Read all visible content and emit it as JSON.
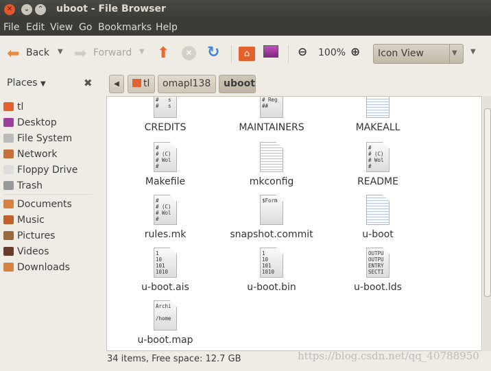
{
  "window": {
    "title": "uboot - File Browser"
  },
  "menu": [
    "File",
    "Edit",
    "View",
    "Go",
    "Bookmarks",
    "Help"
  ],
  "toolbar": {
    "back": "Back",
    "forward": "Forward",
    "zoom": "100%",
    "view": "Icon View"
  },
  "location": {
    "crumbs": [
      "tl",
      "omapl138",
      "uboot"
    ]
  },
  "sidebar": {
    "title": "Places",
    "items": [
      "tl",
      "Desktop",
      "File System",
      "Network",
      "Floppy Drive",
      "Trash",
      "Documents",
      "Music",
      "Pictures",
      "Videos",
      "Downloads"
    ]
  },
  "files": [
    {
      "name": "CREDITS",
      "preview": "#   P\n#   s\n#   s"
    },
    {
      "name": "MAINTAINERS",
      "preview": "##\n# Reg\n##"
    },
    {
      "name": "MAKEALL",
      "preview": ""
    },
    {
      "name": "Makefile",
      "preview": "#\n# (C)\n# Wol\n#"
    },
    {
      "name": "mkconfig",
      "preview": ""
    },
    {
      "name": "README",
      "preview": "#\n# (C)\n# Wol\n#"
    },
    {
      "name": "rules.mk",
      "preview": "#\n# (C)\n# Wol\n#"
    },
    {
      "name": "snapshot.commit",
      "preview": "$Form"
    },
    {
      "name": "u-boot",
      "preview": ""
    },
    {
      "name": "u-boot.ais",
      "preview": "1\n10\n101\n1010"
    },
    {
      "name": "u-boot.bin",
      "preview": "1\n10\n101\n1010"
    },
    {
      "name": "u-boot.lds",
      "preview": "OUTPU\nOUTPU\nENTRY\nSECTI"
    },
    {
      "name": "u-boot.map",
      "preview": "Archi\n\n/home"
    }
  ],
  "status": "34 items, Free space: 12.7 GB",
  "watermark": "https://blog.csdn.net/qq_40788950"
}
